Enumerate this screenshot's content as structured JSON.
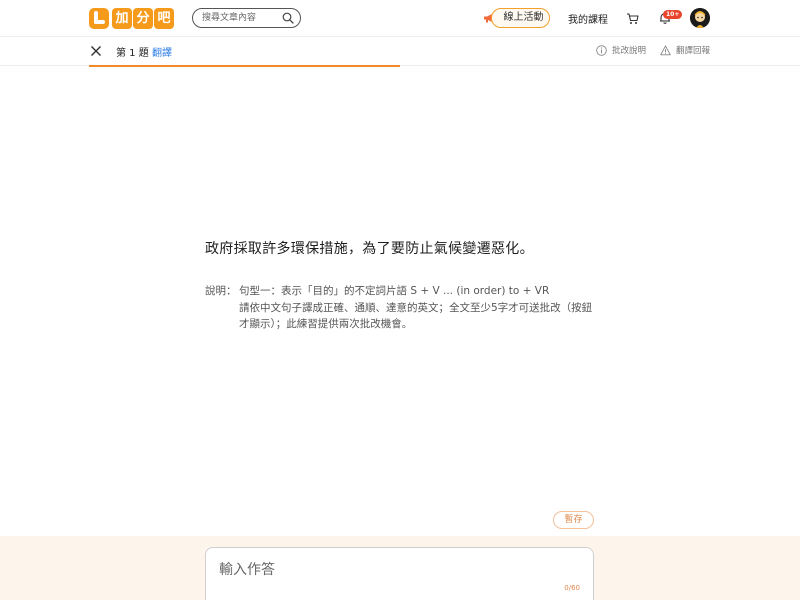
{
  "header": {
    "logo_text": [
      "加",
      "分",
      "吧"
    ],
    "search": {
      "placeholder": "搜尋文章內容",
      "icon": "search-icon"
    },
    "live_button": "線上活動",
    "my_courses": "我的課程",
    "notification_badge": "10+",
    "icons": [
      "megaphone-icon",
      "cart-icon",
      "bell-icon",
      "avatar"
    ]
  },
  "subbar": {
    "question_number": "第 1 題",
    "question_type": "翻譯",
    "explain_link": "批改說明",
    "report_link": "翻譯回報",
    "progress": 0.5
  },
  "question": {
    "text": "政府採取許多環保措施，為了要防止氣候變遷惡化。",
    "note_label": "說明：",
    "note_line1": "句型一：表示「目的」的不定詞片語 S + V ... (in order) to + VR",
    "note_line2": "請依中文句子譯成正確、通順、達意的英文；全文至少5字才可送批改（按鈕才顯示）；此練習提供兩次批改機會。"
  },
  "answer": {
    "save_button": "暫存",
    "placeholder": "輸入作答",
    "counter": "0/60"
  },
  "colors": {
    "brand": "#f59a1b",
    "progress": "#f28a2c",
    "link_blue": "#2c7be5",
    "badge": "#e8452c",
    "bottom_bg": "#fdf4ec"
  }
}
